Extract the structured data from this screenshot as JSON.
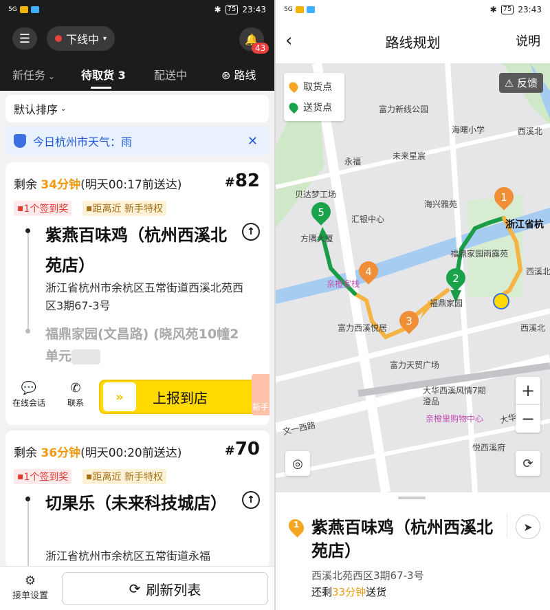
{
  "status_bar": {
    "time": "23:43",
    "battery": "75",
    "signal": "5G"
  },
  "left": {
    "menu_icon": "menu-icon",
    "status": "下线中",
    "notifications": "43",
    "tabs": [
      "新任务",
      "待取货 3",
      "配送中",
      "路线"
    ],
    "sort": "默认排序",
    "weather": "今日杭州市天气：雨",
    "orders": [
      {
        "remain_prefix": "剩余",
        "remain": "34分钟",
        "deadline": "(明天00:17前送达)",
        "number": "82",
        "tag1": "1个签到奖",
        "tag2": "距离近 新手特权",
        "shop": "紫燕百味鸡（杭州西溪北苑店）",
        "address": "浙江省杭州市余杭区五常街道西溪北苑西区3期67-3号",
        "customer": "福鼎家园(文昌路) (晓风苑10幢2单元"
      },
      {
        "remain_prefix": "剩余",
        "remain": "36分钟",
        "deadline": "(明天00:20前送达)",
        "number": "70",
        "tag1": "1个签到奖",
        "tag2": "距离近 新手特权",
        "shop": "切果乐（未来科技城店）",
        "address": "浙江省杭州市余杭区五常街道永福"
      }
    ],
    "actions": {
      "chat": "在线会话",
      "contact": "联系",
      "report": "上报到店",
      "new": "新手"
    },
    "bottom": {
      "settings": "接单设置",
      "refresh": "刷新列表"
    }
  },
  "right": {
    "title": "路线规划",
    "explain": "说明",
    "legend": {
      "pickup": "取货点",
      "delivery": "送货点"
    },
    "feedback": "反馈",
    "map_labels": {
      "fuli_xinxian": "富力新线公园",
      "haishu_school": "海曙小学",
      "xixi_bei": "西溪北",
      "yongfu": "永福",
      "weilai_xingchen": "未来星宸",
      "beidamen": "贝达梦工场",
      "haixing": "海兴雅苑",
      "huiyin": "汇银中心",
      "zhejiang": "浙江省杭",
      "fangli": "方隅大厦",
      "fuding_yulu": "福鼎家园雨露苑",
      "xixibei2": "西溪北",
      "qincheng": "亲橙客栈",
      "fuding": "福鼎家园",
      "fuli_xixi": "富力西溪悦居",
      "xixi3": "西溪北",
      "fuli_tianmao": "富力天贸广场",
      "dahua": "大华西溪风情7期澄品",
      "qincheng_mall": "亲橙里购物中心",
      "wenyi": "文一西路",
      "daxi": "大华",
      "yuexi": "悦西溪府"
    },
    "route_points": [
      "1",
      "2",
      "3",
      "4",
      "5"
    ],
    "sheet": {
      "index": "1",
      "shop": "紫燕百味鸡（杭州西溪北苑店）",
      "address": "西溪北苑西区3期67-3号",
      "remain_prefix": "还剩",
      "remain": "33分钟",
      "remain_suffix": "送货"
    }
  },
  "colors": {
    "accent": "#ffd900",
    "orange": "#f09a12",
    "green": "#1aa34a",
    "route_orange": "#f5b342"
  }
}
